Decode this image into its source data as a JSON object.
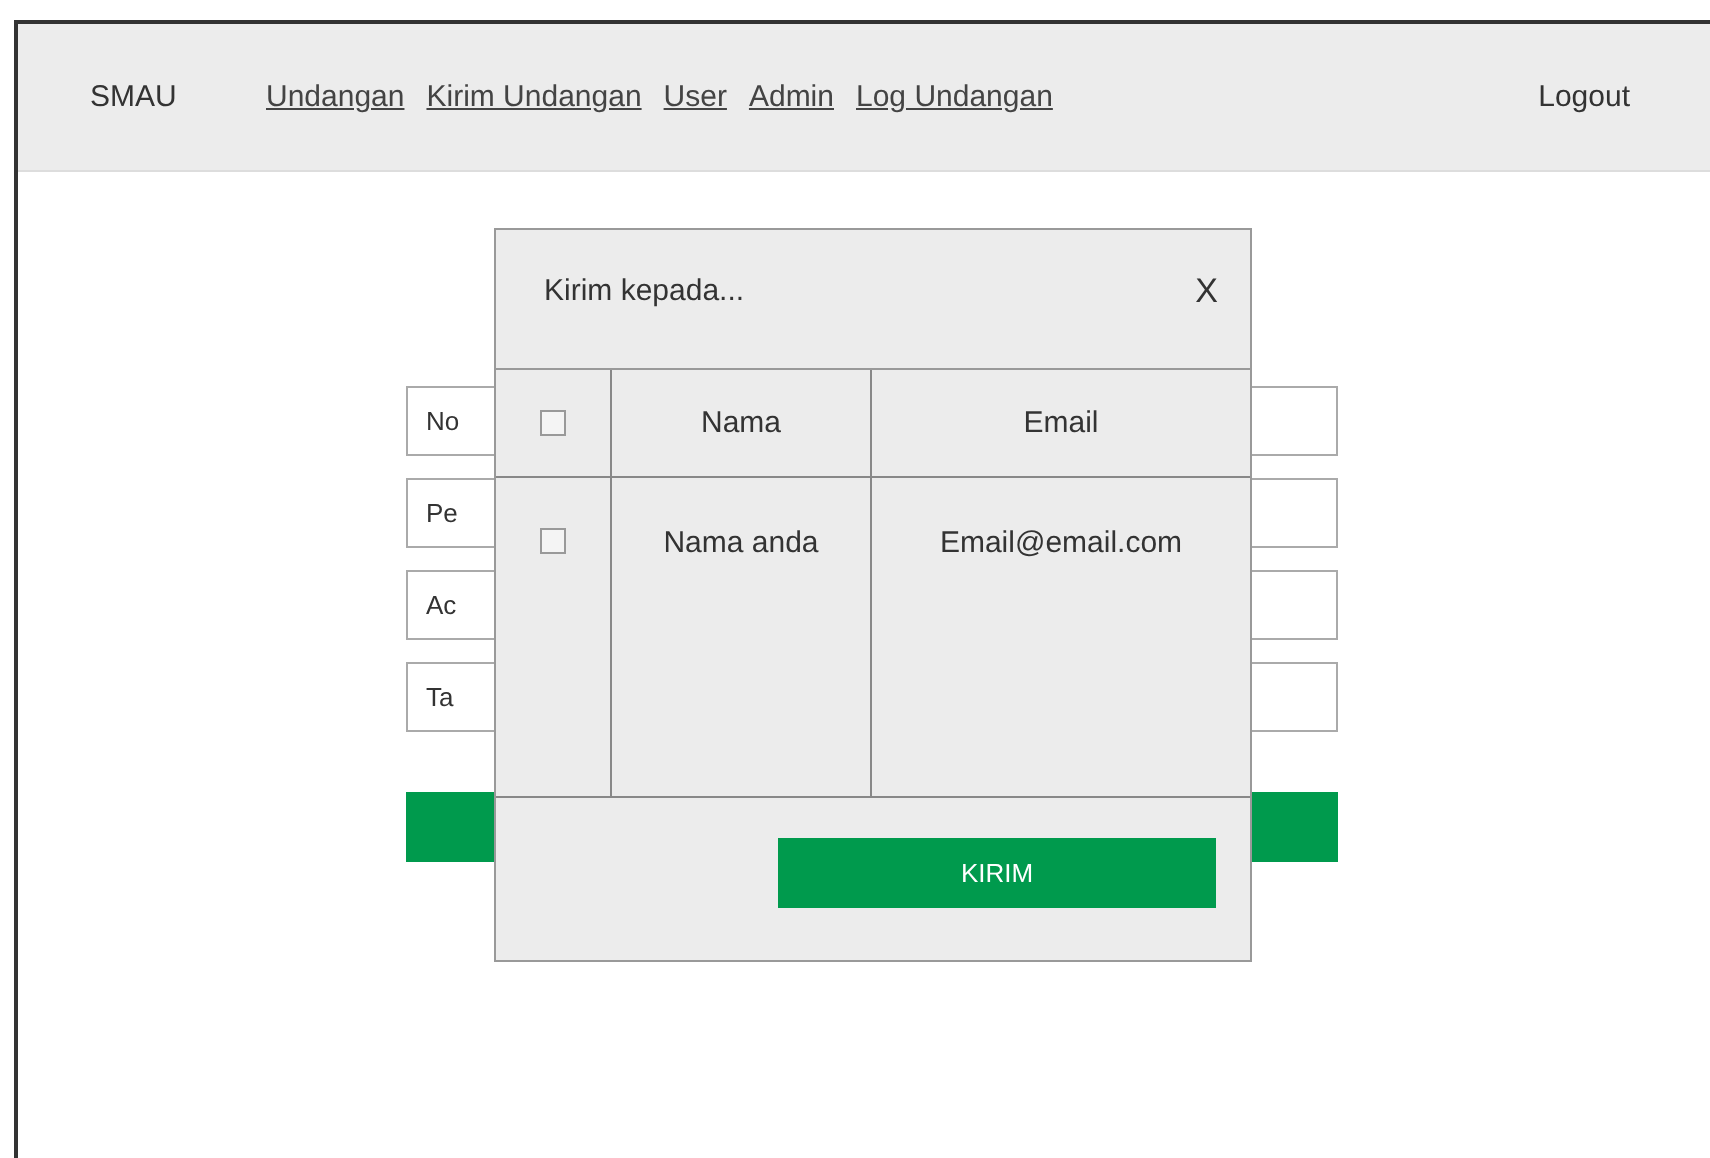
{
  "header": {
    "brand": "SMAU",
    "nav": [
      {
        "label": "Undangan"
      },
      {
        "label": "Kirim Undangan"
      },
      {
        "label": "User"
      },
      {
        "label": "Admin"
      },
      {
        "label": "Log Undangan"
      }
    ],
    "logout": "Logout"
  },
  "form": {
    "fields": [
      {
        "label": "No"
      },
      {
        "label": "Pe"
      },
      {
        "label": "Ac"
      },
      {
        "label": "Ta"
      }
    ]
  },
  "dialog": {
    "title": "Kirim kepada...",
    "close": "X",
    "table": {
      "select_all_checked": false,
      "columns": [
        "Nama",
        "Email"
      ],
      "rows": [
        {
          "checked": false,
          "cells": [
            "Nama anda",
            "Email@email.com"
          ]
        }
      ]
    },
    "button": "KIRIM"
  }
}
